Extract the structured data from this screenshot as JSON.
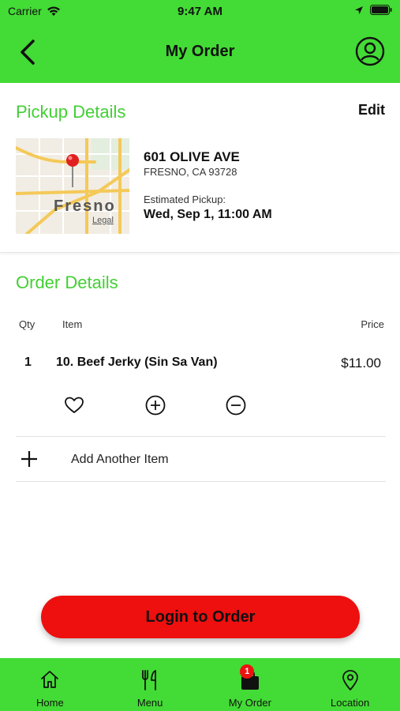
{
  "status_bar": {
    "carrier": "Carrier",
    "time": "9:47 AM"
  },
  "nav": {
    "title": "My Order"
  },
  "pickup": {
    "section_title": "Pickup Details",
    "edit_label": "Edit",
    "map": {
      "city_label": "Fresno",
      "legal_label": "Legal"
    },
    "address_line1": "601 OLIVE AVE",
    "address_line2": "FRESNO, CA 93728",
    "estimated_label": "Estimated Pickup:",
    "estimated_value": "Wed, Sep 1, 11:00 AM"
  },
  "order": {
    "section_title": "Order Details",
    "columns": {
      "qty": "Qty",
      "item": "Item",
      "price": "Price"
    },
    "items": [
      {
        "qty": "1",
        "name": "10. Beef Jerky (Sin Sa Van)",
        "price": "$11.00"
      }
    ],
    "add_item_label": "Add Another Item"
  },
  "login_button": "Login to Order",
  "tabs": [
    {
      "label": "Home",
      "icon": "home-icon"
    },
    {
      "label": "Menu",
      "icon": "utensils-icon"
    },
    {
      "label": "My Order",
      "icon": "bag-icon",
      "badge": "1"
    },
    {
      "label": "Location",
      "icon": "location-pin-icon"
    }
  ],
  "colors": {
    "brand_green": "#43db35",
    "title_green": "#43cf34",
    "cta_red": "#ee0f0f"
  }
}
